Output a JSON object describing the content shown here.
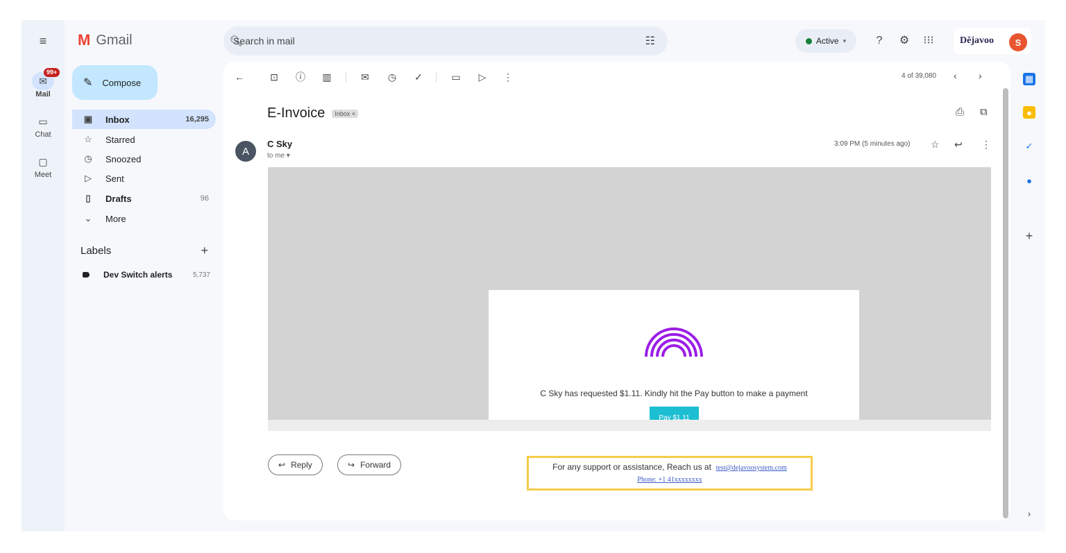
{
  "app": {
    "name": "Gmail",
    "logo_letter": "M"
  },
  "search": {
    "placeholder": "Search in mail"
  },
  "status": {
    "label": "Active",
    "color": "#188038"
  },
  "brand": {
    "text": "Dĕjavoo"
  },
  "account": {
    "initial": "S",
    "color": "#e8552f"
  },
  "rail": {
    "items": [
      {
        "label": "Mail",
        "badge": "99+"
      },
      {
        "label": "Chat"
      },
      {
        "label": "Meet"
      }
    ]
  },
  "compose": {
    "label": "Compose"
  },
  "nav": {
    "items": [
      {
        "label": "Inbox",
        "count": "16,295"
      },
      {
        "label": "Starred",
        "count": ""
      },
      {
        "label": "Snoozed",
        "count": ""
      },
      {
        "label": "Sent",
        "count": ""
      },
      {
        "label": "Drafts",
        "count": "96"
      },
      {
        "label": "More",
        "count": ""
      }
    ]
  },
  "labels": {
    "title": "Labels",
    "items": [
      {
        "label": "Dev Switch alerts",
        "count": "5,737"
      }
    ]
  },
  "toolbar": {
    "pager": "4 of 39,080"
  },
  "message": {
    "subject": "E-Invoice",
    "chip": "Inbox ×",
    "sender": "C Sky",
    "sender_initial": "A",
    "to": "to me ▾",
    "time": "3:09 PM (5 minutes ago)",
    "body": {
      "request_text": "C Sky has requested $1.11. Kindly hit the Pay button to make a payment",
      "pay_label": "Pay $1.11",
      "pay_color": "#1cbed2",
      "arch_color": "#9b1de8",
      "support_text": "For any support or assistance, Reach us at",
      "support_email": "test@dejavoosystem.com",
      "support_phone": "Phone: +1 41xxxxxxxx",
      "highlight_color": "#f6cc4a"
    }
  },
  "actions": {
    "reply": "Reply",
    "forward": "Forward"
  }
}
